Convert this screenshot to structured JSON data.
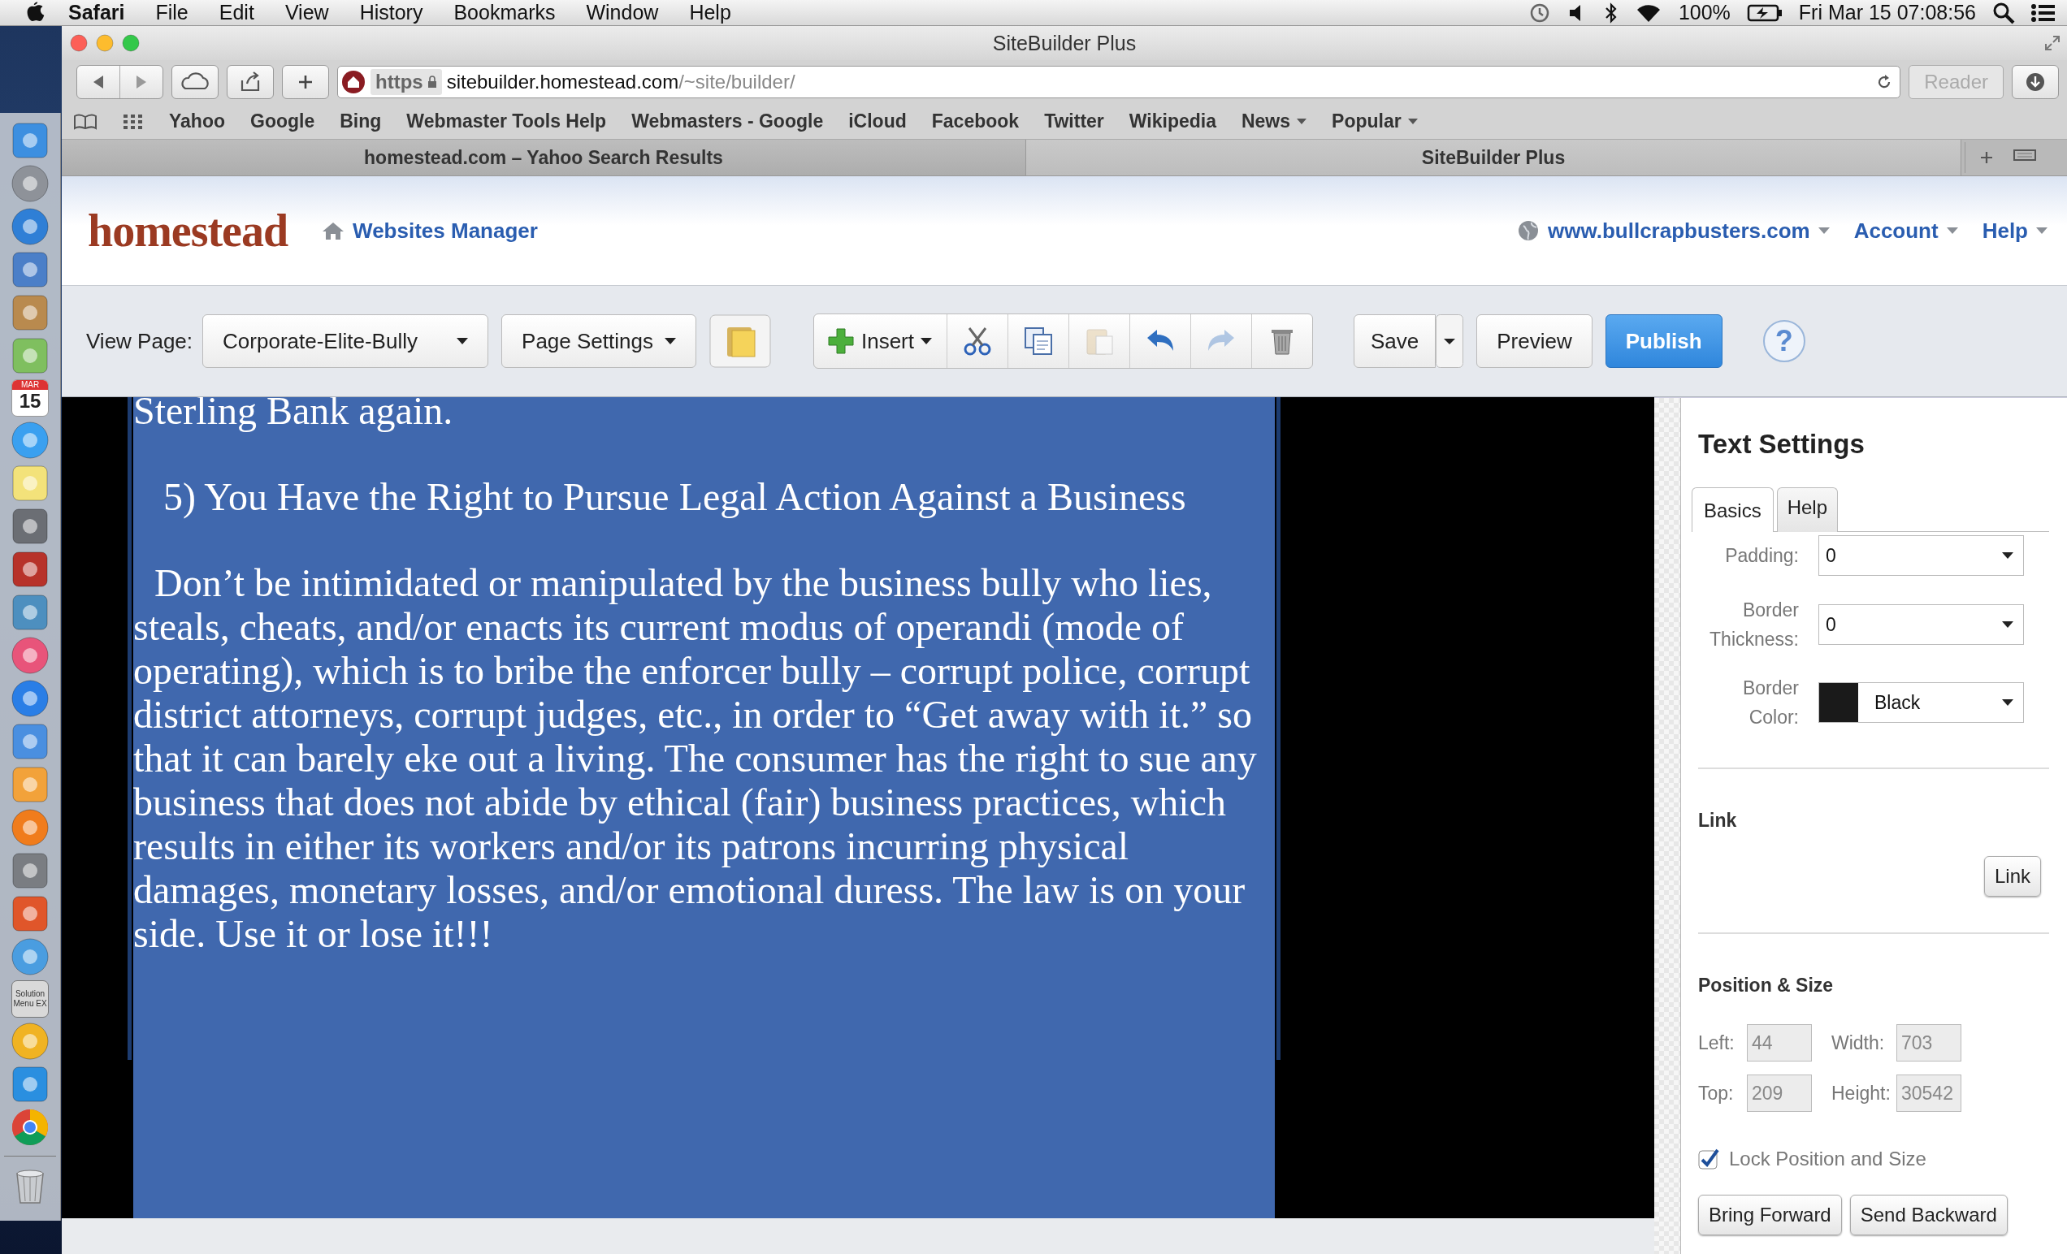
{
  "menu_bar": {
    "app": "Safari",
    "items": [
      "File",
      "Edit",
      "View",
      "History",
      "Bookmarks",
      "Window",
      "Help"
    ],
    "battery": "100%",
    "clock": "Fri Mar 15  07:08:56"
  },
  "dock": {
    "items": [
      {
        "kind": "finder"
      },
      {
        "kind": "rocket"
      },
      {
        "kind": "compass"
      },
      {
        "kind": "stamp"
      },
      {
        "kind": "addressbook"
      },
      {
        "kind": "map"
      },
      {
        "kind": "calendar",
        "month": "MAR",
        "day": "15"
      },
      {
        "kind": "bubble"
      },
      {
        "kind": "notepad"
      },
      {
        "kind": "camera"
      },
      {
        "kind": "curtain"
      },
      {
        "kind": "photo"
      },
      {
        "kind": "music"
      },
      {
        "kind": "appstore"
      },
      {
        "kind": "podium"
      },
      {
        "kind": "pen"
      },
      {
        "kind": "book"
      },
      {
        "kind": "gear"
      },
      {
        "kind": "letter-p"
      },
      {
        "kind": "globe"
      },
      {
        "kind": "label",
        "text": "Solution Menu EX"
      },
      {
        "kind": "letter-o"
      },
      {
        "kind": "letter-w"
      },
      {
        "kind": "chrome"
      },
      {
        "kind": "trash"
      }
    ]
  },
  "browser": {
    "title": "SiteBuilder Plus",
    "scheme": "https",
    "host": "sitebuilder.homestead.com",
    "path": "/~site/builder/",
    "reader": "Reader",
    "bookmarks": [
      {
        "label": "Yahoo",
        "menu": false
      },
      {
        "label": "Google",
        "menu": false
      },
      {
        "label": "Bing",
        "menu": false
      },
      {
        "label": "Webmaster Tools Help",
        "menu": false
      },
      {
        "label": "Webmasters - Google",
        "menu": false
      },
      {
        "label": "iCloud",
        "menu": false
      },
      {
        "label": "Facebook",
        "menu": false
      },
      {
        "label": "Twitter",
        "menu": false
      },
      {
        "label": "Wikipedia",
        "menu": false
      },
      {
        "label": "News",
        "menu": true
      },
      {
        "label": "Popular",
        "menu": true
      }
    ],
    "tabs": [
      {
        "label": "homestead.com – Yahoo Search Results",
        "selected": false
      },
      {
        "label": "SiteBuilder Plus",
        "selected": true
      }
    ]
  },
  "header": {
    "logo": "homestead",
    "nav": "Websites Manager",
    "site": "www.bullcrapbusters.com",
    "menus": [
      "Account",
      "Help"
    ]
  },
  "toolbar": {
    "view_page_label": "View Page:",
    "page": "Corporate-Elite-Bully",
    "page_settings": "Page Settings",
    "insert": "Insert",
    "tools": [
      {
        "kind": "cut",
        "disabled": false
      },
      {
        "kind": "copy",
        "disabled": false
      },
      {
        "kind": "paste",
        "disabled": true
      },
      {
        "kind": "undo",
        "disabled": false
      },
      {
        "kind": "redo",
        "disabled": true
      },
      {
        "kind": "delete",
        "disabled": false
      }
    ],
    "save": "Save",
    "preview": "Preview",
    "publish": "Publish",
    "help": "?"
  },
  "canvas": {
    "paragraphs": [
      {
        "kind": "line",
        "text": "Sterling Bank again."
      },
      {
        "kind": "heading",
        "text": "5) You Have the Right to Pursue Legal Action Against a Business"
      },
      {
        "kind": "body",
        "text": "Don’t be intimidated or manipulated by the business bully who lies, steals, cheats, and/or enacts its current modus of operandi (mode of operating), which is to bribe the enforcer bully – corrupt police, corrupt district attorneys, corrupt judges, etc., in order to “Get away with it.” so that it can barely eke out a living. The consumer has the right to sue any business that does not abide by ethical (fair) business practices, which results in either its workers and/or its patrons incurring physical damages, monetary losses, and/or emotional duress. The law is on your side. Use it or lose it!!!"
      }
    ]
  },
  "text_settings": {
    "title": "Text Settings",
    "tabs": [
      {
        "label": "Basics",
        "selected": true
      },
      {
        "label": "Help",
        "selected": false
      }
    ],
    "padding": {
      "label": "Padding:",
      "value": "0"
    },
    "border_thickness": {
      "label": "Border Thickness:",
      "value": "0"
    },
    "border_color": {
      "label": "Border Color:",
      "value": "Black",
      "color": "#1a1a1a"
    },
    "link_heading": "Link",
    "link_button": "Link",
    "position_heading": "Position & Size",
    "fields": [
      {
        "label": "Left:",
        "value": "44"
      },
      {
        "label": "Width:",
        "value": "703"
      },
      {
        "label": "Top:",
        "value": "209"
      },
      {
        "label": "Height:",
        "value": "30542"
      }
    ],
    "lock": {
      "label": "Lock Position and Size",
      "checked": true
    },
    "buttons": [
      "Bring Forward",
      "Send Backward"
    ]
  }
}
